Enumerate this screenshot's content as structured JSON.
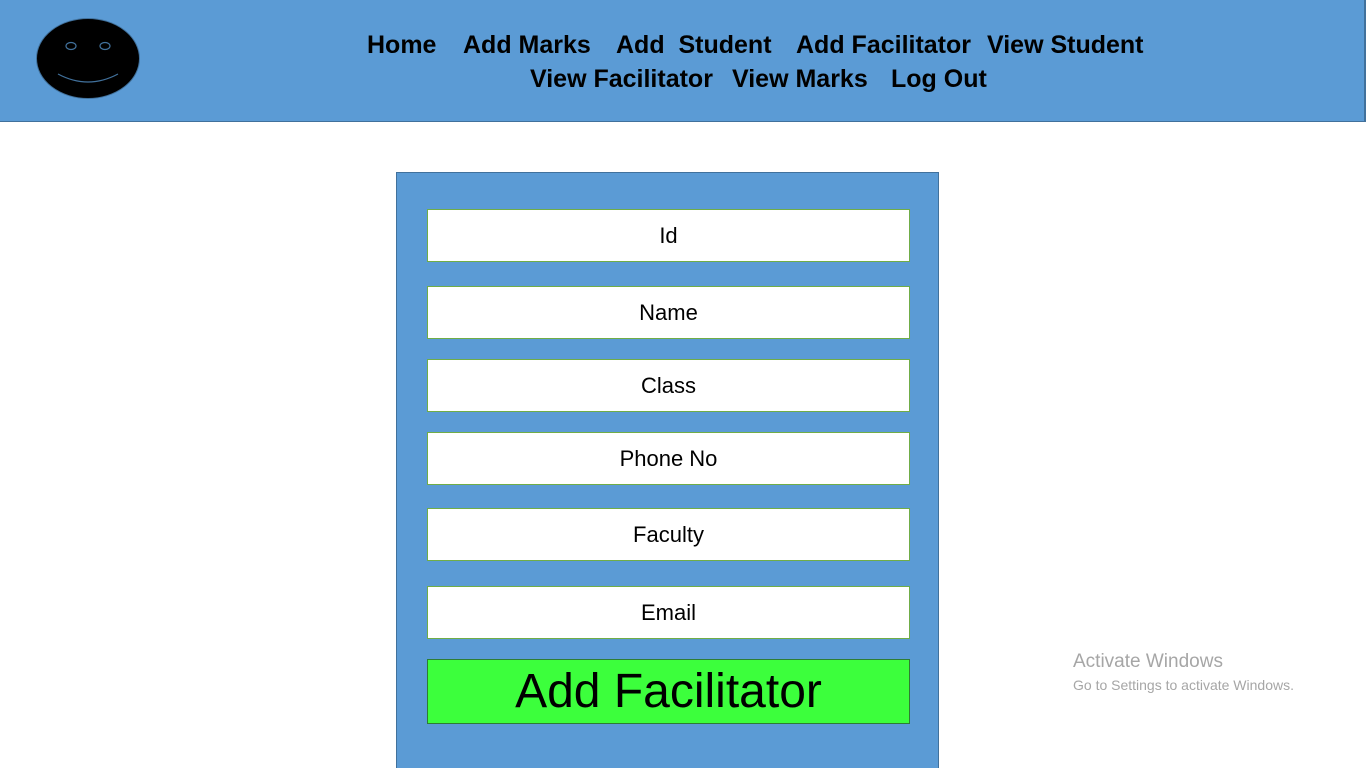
{
  "header": {
    "background": "#5b9bd5",
    "logo_icon": "smiley-face-icon",
    "nav": {
      "home": "Home",
      "add_marks": "Add Marks",
      "add_student": "Add  Student",
      "add_facilitator": "Add Facilitator",
      "view_student": "View Student",
      "view_facilitator": "View Facilitator",
      "view_marks": "View Marks",
      "log_out": "Log Out"
    }
  },
  "form": {
    "background": "#5b9bd5",
    "fields": {
      "id": "Id",
      "name": "Name",
      "class": "Class",
      "phone": "Phone No",
      "faculty": "Faculty",
      "email": "Email"
    },
    "submit_label": "Add Facilitator",
    "submit_color": "#3cff3c"
  },
  "watermark": {
    "title": "Activate Windows",
    "subtitle": "Go to Settings to activate Windows."
  }
}
